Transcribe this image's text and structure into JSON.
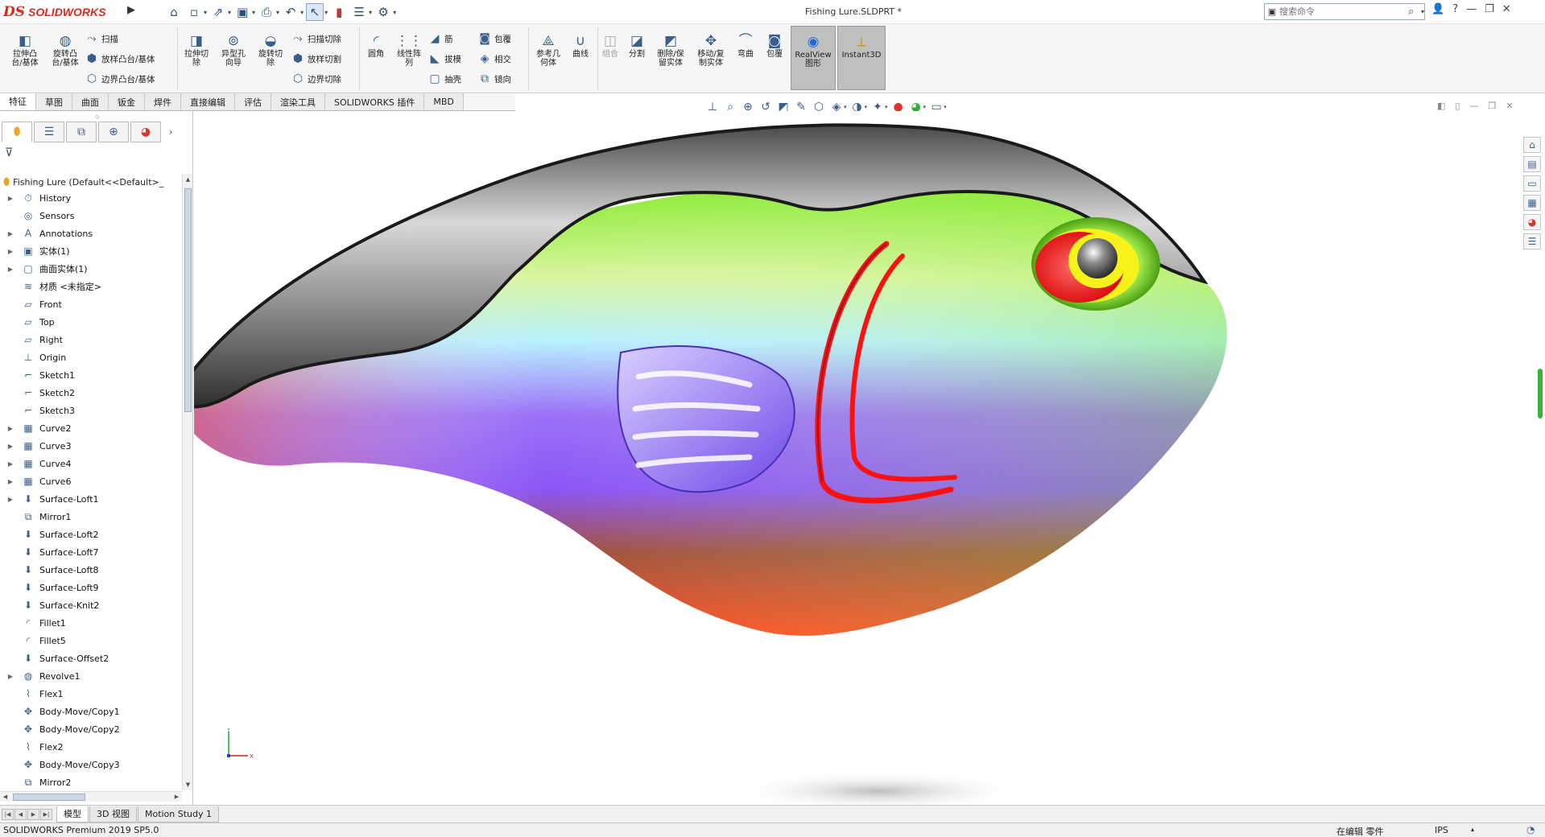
{
  "titlebar": {
    "brand_mark": "DS",
    "brand_name": "SOLIDWORKS",
    "document_title": "Fishing Lure.SLDPRT *",
    "search_placeholder": "搜索命令",
    "quick_access_icons": [
      "home-icon",
      "new-icon",
      "open-icon",
      "save-icon",
      "print-icon",
      "undo-icon",
      "select-icon",
      "rebuild-icon",
      "file-properties-icon",
      "options-icon"
    ],
    "window_icons": [
      "user-icon",
      "help-icon",
      "minimize-icon",
      "restore-icon",
      "close-icon"
    ]
  },
  "ribbon": {
    "extrude_boss": "拉伸凸\n台/基体",
    "revolve_boss": "旋转凸\n台/基体",
    "sweep": "扫描",
    "loft": "放样凸台/基体",
    "boundary_boss": "边界凸台/基体",
    "extrude_cut": "拉伸切\n除",
    "hole_wizard": "异型孔\n向导",
    "revolve_cut": "旋转切\n除",
    "swept_cut": "扫描切除",
    "lofted_cut": "放样切割",
    "boundary_cut": "边界切除",
    "fillet": "圆角",
    "linear_pattern": "线性阵\n列",
    "rib": "筋",
    "draft": "拔模",
    "shell": "抽壳",
    "wrap": "包覆",
    "intersect": "相交",
    "mirror": "镜向",
    "reference_geometry": "参考几\n何体",
    "curves": "曲线",
    "combine": "组合",
    "split": "分割",
    "delete_keep_body": "删除/保\n留实体",
    "move_copy_body": "移动/复\n制实体",
    "flex": "弯曲",
    "wrap2": "包覆",
    "realview": "RealView\n图形",
    "instant3d": "Instant3D"
  },
  "command_tabs": [
    "特征",
    "草图",
    "曲面",
    "钣金",
    "焊件",
    "直接编辑",
    "评估",
    "渲染工具",
    "SOLIDWORKS 插件",
    "MBD"
  ],
  "active_command_tab": "特征",
  "feature_manager": {
    "root": "Fishing Lure  (Default<<Default>_",
    "items": [
      {
        "label": "History",
        "icon": "history-icon",
        "expandable": true
      },
      {
        "label": "Sensors",
        "icon": "sensor-icon",
        "expandable": false
      },
      {
        "label": "Annotations",
        "icon": "annotation-icon",
        "expandable": true
      },
      {
        "label": "实体(1)",
        "icon": "solid-body-icon",
        "expandable": true
      },
      {
        "label": "曲面实体(1)",
        "icon": "surface-body-icon",
        "expandable": true
      },
      {
        "label": "材质 <未指定>",
        "icon": "material-icon",
        "expandable": false
      },
      {
        "label": "Front",
        "icon": "plane-icon",
        "expandable": false
      },
      {
        "label": "Top",
        "icon": "plane-icon",
        "expandable": false
      },
      {
        "label": "Right",
        "icon": "plane-icon",
        "expandable": false
      },
      {
        "label": "Origin",
        "icon": "origin-icon",
        "expandable": false
      },
      {
        "label": "Sketch1",
        "icon": "sketch-icon",
        "expandable": false
      },
      {
        "label": "Sketch2",
        "icon": "sketch-icon",
        "expandable": false
      },
      {
        "label": "Sketch3",
        "icon": "sketch-icon",
        "expandable": false
      },
      {
        "label": "Curve2",
        "icon": "curve-icon",
        "expandable": true
      },
      {
        "label": "Curve3",
        "icon": "curve-icon",
        "expandable": true
      },
      {
        "label": "Curve4",
        "icon": "curve-icon",
        "expandable": true
      },
      {
        "label": "Curve6",
        "icon": "curve-icon",
        "expandable": true
      },
      {
        "label": "Surface-Loft1",
        "icon": "surface-loft-icon",
        "expandable": true
      },
      {
        "label": "Mirror1",
        "icon": "mirror-icon",
        "expandable": false
      },
      {
        "label": "Surface-Loft2",
        "icon": "surface-loft-icon",
        "expandable": false
      },
      {
        "label": "Surface-Loft7",
        "icon": "surface-loft-icon",
        "expandable": false
      },
      {
        "label": "Surface-Loft8",
        "icon": "surface-loft-icon",
        "expandable": false
      },
      {
        "label": "Surface-Loft9",
        "icon": "surface-loft-icon",
        "expandable": false
      },
      {
        "label": "Surface-Knit2",
        "icon": "surface-knit-icon",
        "expandable": false
      },
      {
        "label": "Fillet1",
        "icon": "fillet-icon",
        "expandable": false
      },
      {
        "label": "Fillet5",
        "icon": "fillet-icon",
        "expandable": false
      },
      {
        "label": "Surface-Offset2",
        "icon": "surface-offset-icon",
        "expandable": false
      },
      {
        "label": "Revolve1",
        "icon": "revolve-icon",
        "expandable": true
      },
      {
        "label": "Flex1",
        "icon": "flex-icon",
        "expandable": false
      },
      {
        "label": "Body-Move/Copy1",
        "icon": "move-copy-icon",
        "expandable": false
      },
      {
        "label": "Body-Move/Copy2",
        "icon": "move-copy-icon",
        "expandable": false
      },
      {
        "label": "Flex2",
        "icon": "flex-icon",
        "expandable": false
      },
      {
        "label": "Body-Move/Copy3",
        "icon": "move-copy-icon",
        "expandable": false
      },
      {
        "label": "Mirror2",
        "icon": "mirror-icon",
        "expandable": false
      }
    ]
  },
  "bottom_tabs": [
    "模型",
    "3D 视图",
    "Motion Study 1"
  ],
  "active_bottom_tab": "模型",
  "status": {
    "product": "SOLIDWORKS Premium 2019 SP5.0",
    "editing": "在编辑 零件",
    "units": "IPS"
  },
  "colors": {
    "brand": "#d52b1e",
    "eye_red": "#e81616",
    "gill_red": "#ff1010",
    "belly_orange": "#ff5a2a",
    "body_violet": "#8b55f6",
    "head_green": "#7ee81e"
  }
}
